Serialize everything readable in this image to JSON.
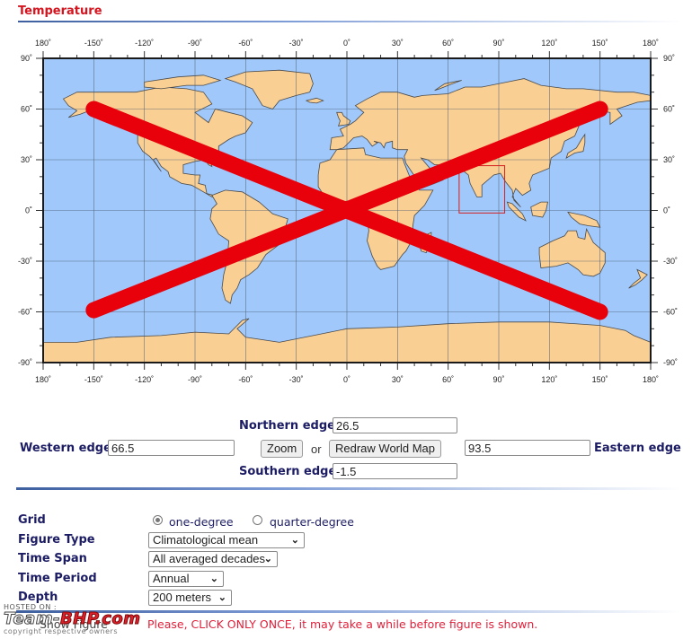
{
  "page": {
    "title": "Temperature"
  },
  "map": {
    "colors": {
      "ocean": "#a0c8fa",
      "land": "#f9cf94",
      "coast": "#4a4a4a",
      "grid": "#4a5a70",
      "cross": "#e8000a",
      "selection_box": "#d42020",
      "frame": "#1a1a1a"
    },
    "lon_ticks": [
      "180˚",
      "-150˚",
      "-120˚",
      "-90˚",
      "-60˚",
      "-30˚",
      "0˚",
      "30˚",
      "60˚",
      "90˚",
      "120˚",
      "150˚",
      "180˚"
    ],
    "lat_ticks": [
      "90˚",
      "60˚",
      "30˚",
      "0˚",
      "-30˚",
      "-60˚",
      "-90˚"
    ],
    "cross_lines": [
      {
        "from": {
          "lon": -150,
          "lat": 60
        },
        "to": {
          "lon": 150,
          "lat": -60
        }
      },
      {
        "from": {
          "lon": -150,
          "lat": -59
        },
        "to": {
          "lon": 150,
          "lat": 60
        }
      }
    ],
    "selection": {
      "west": 66.5,
      "east": 93.5,
      "north": 26.5,
      "south": -1.5
    }
  },
  "bounds": {
    "northern_label": "Northern edge",
    "northern_value": "26.5",
    "western_label": "Western edge",
    "western_value": "66.5",
    "southern_label": "Southern edge",
    "southern_value": "-1.5",
    "eastern_label": "Eastern edge",
    "eastern_value": "93.5",
    "zoom_button": "Zoom",
    "or_text": "or",
    "redraw_button": "Redraw World Map"
  },
  "options": {
    "grid_label": "Grid",
    "grid_options": [
      {
        "label": "one-degree",
        "selected": true
      },
      {
        "label": "quarter-degree",
        "selected": false
      }
    ],
    "figure_type_label": "Figure Type",
    "figure_type_value": "Climatological mean",
    "time_span_label": "Time Span",
    "time_span_value": "All averaged decades",
    "time_period_label": "Time Period",
    "time_period_value": "Annual",
    "depth_label": "Depth",
    "depth_value": "200 meters"
  },
  "footer": {
    "show_figure_button": "Show Figure",
    "warning": "Please, CLICK ONLY ONCE, it may take a while before figure is shown."
  },
  "watermark": {
    "hosted": "HOSTED ON :",
    "brand_left": "Team-",
    "brand_right": "BHP.com",
    "copyright": "copyright respective owners"
  }
}
